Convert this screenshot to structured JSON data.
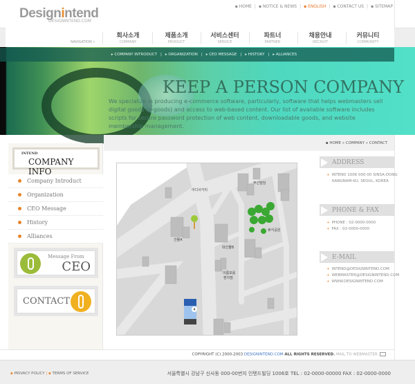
{
  "logo": {
    "text_a": "Design",
    "text_i": "i",
    "text_b": "ntend",
    "sub": "DESIGNINTEND.COM"
  },
  "topnav": [
    {
      "label": "HOME"
    },
    {
      "label": "NOTICE & NEWS"
    },
    {
      "label": "ENGLISH",
      "active": true
    },
    {
      "label": "CONTACT US"
    },
    {
      "label": "SITEMAP"
    }
  ],
  "nav": {
    "label": "NAVIGATION »",
    "items": [
      {
        "ko": "회사소개",
        "en": "COMPANY"
      },
      {
        "ko": "제품소개",
        "en": "PRODUCT"
      },
      {
        "ko": "서비스센터",
        "en": "SERVICE"
      },
      {
        "ko": "파트너",
        "en": "PARTNER"
      },
      {
        "ko": "채용안내",
        "en": "RECRUIT"
      },
      {
        "ko": "커뮤니티",
        "en": "COMMUNITY"
      }
    ]
  },
  "subnav": [
    "COMPANY INTRODUCT",
    "ORGANIZATION",
    "CEO MESSAGE",
    "HISTORY",
    "ALLIANCES"
  ],
  "banner": {
    "slogan": "KEEP A PERSON COMPANY",
    "body": "We specialize in producing e-commerce software, particularly, software that helps webmasters sell digital goods (e-goods) and access to web-based content. Our list of available software includes scripts for secure password protection of web content, downloadable goods, and website membership management."
  },
  "breadcrumb": [
    "HOME",
    "COMPANY",
    "CONTACT"
  ],
  "sidebar": {
    "small": "INTEND",
    "title": "COMPANY INFO",
    "items": [
      "Company Introduct",
      "Organization",
      "CEO Message",
      "History",
      "Alliances"
    ],
    "ceo_small": "Message From",
    "ceo_big": "CEO",
    "contact": "CONTACT"
  },
  "map": {
    "labels": [
      "어디사거리",
      "무신빌딩",
      "건물A",
      "대건물B",
      "휴식공원",
      "이름모를",
      "편의점"
    ],
    "marker": "4"
  },
  "info": [
    {
      "title": "ADDRESS",
      "lines": [
        "INTEND 1006 000-00 SINSA-DONG",
        "KANGNAM-KU, SEOUL, KOREA"
      ]
    },
    {
      "title": "PHONE & FAX",
      "lines": [
        "PHONE : 02-0000-0000",
        "FAX : 02-0000-0000"
      ]
    },
    {
      "title": "E-MAIL",
      "lines": [
        "INTEND@DESIGNINTEND.COM",
        "WEBMASTER@DESIGNINTEND.COM",
        "WWW.DESIGNINTEND.COM"
      ]
    }
  ],
  "copyright": {
    "pre": "COPYRIGHT (C) 2000-2003",
    "link": "DESIGNINTEND.COM",
    "post": "ALL RIGHTS RESERVED.",
    "mail": "MAIL TO WEBMASTER."
  },
  "footer": {
    "privacy": "PRIVACY POLICY",
    "terms": "TERMS OF SERVICE",
    "address": "서울특별시 강남구 신사동 000-00번지 인텐드빌딩 1006호 TEL : 02-0000-00000 FAX : 02-0000-0000"
  },
  "colors": {
    "accent": "#e8842c",
    "teal": "#4fd8c0",
    "link": "#3b6fbf"
  }
}
